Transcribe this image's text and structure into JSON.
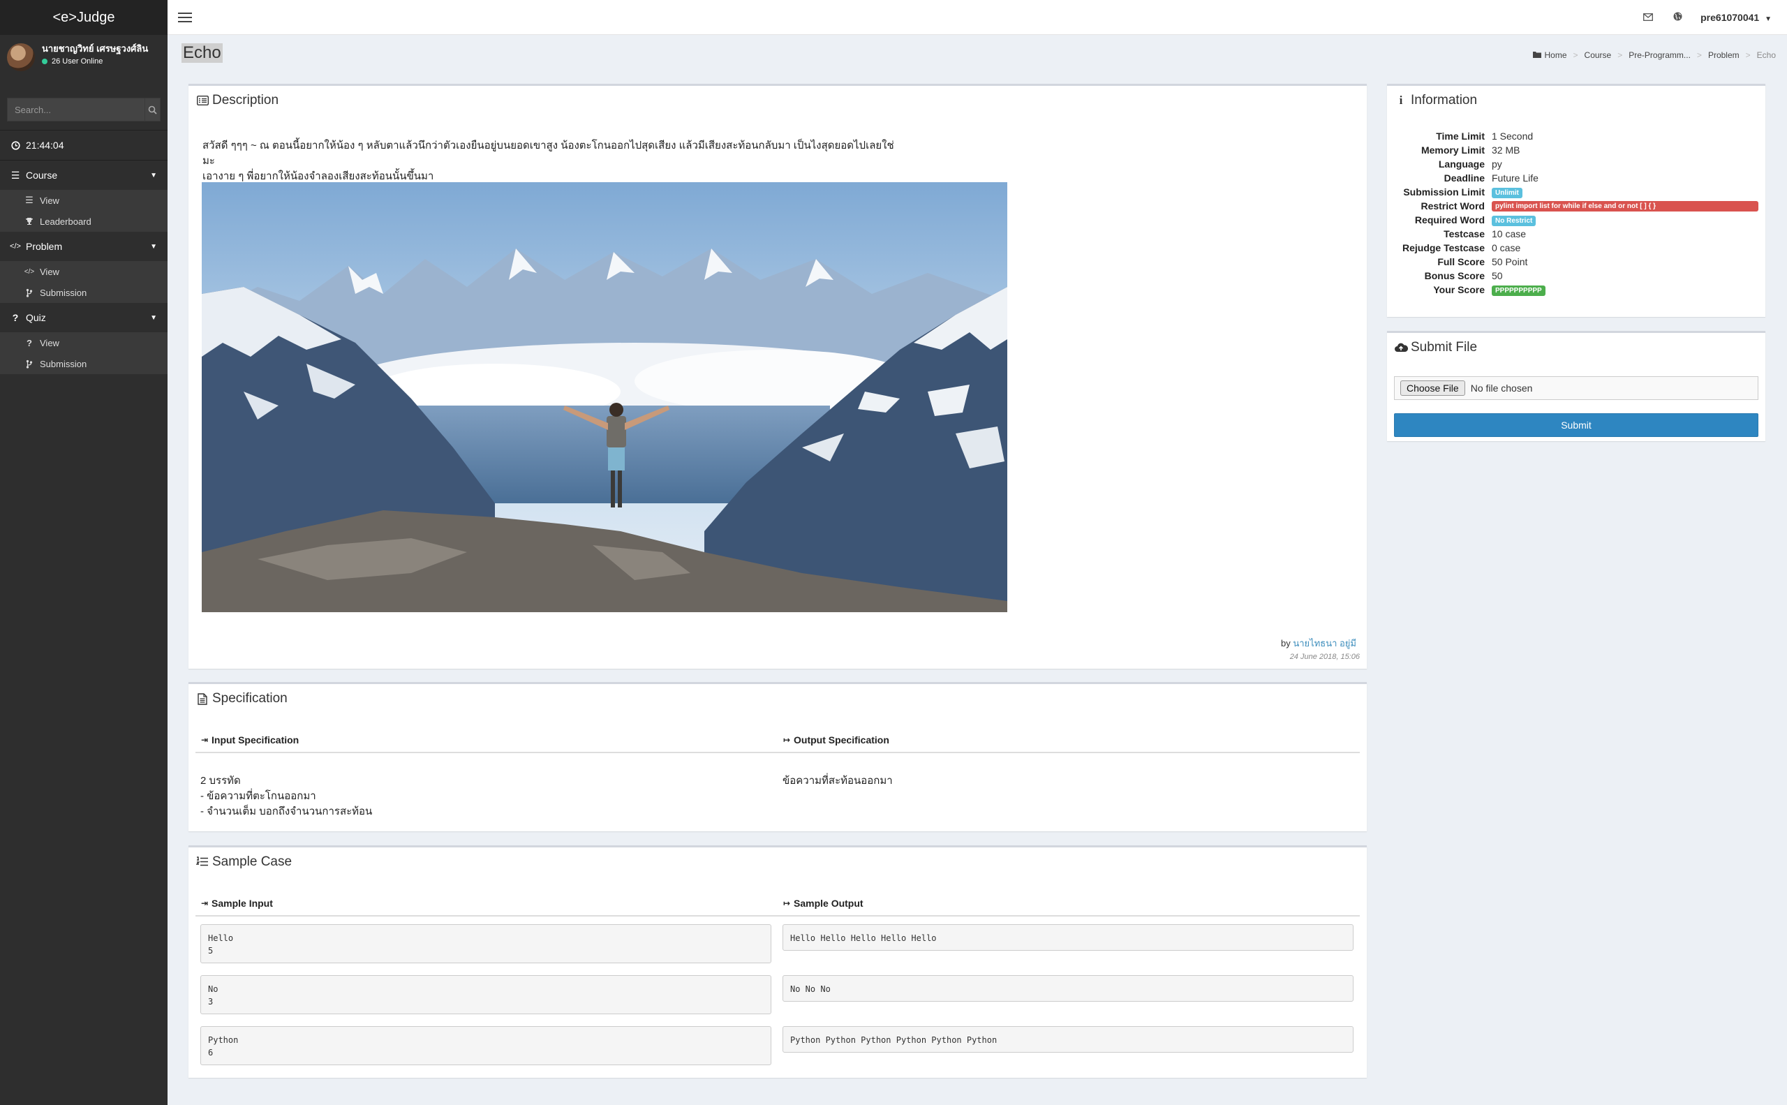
{
  "brand": "<e>Judge",
  "user": {
    "name": "นายชาญวิทย์ เศรษฐวงศ์ลิน",
    "online_text": "26 User Online"
  },
  "search": {
    "placeholder": "Search..."
  },
  "clock": "21:44:04",
  "sidebar": {
    "groups": [
      {
        "label": "Course",
        "icon": "list-icon",
        "items": [
          {
            "label": "View",
            "icon": "list-icon"
          },
          {
            "label": "Leaderboard",
            "icon": "trophy-icon"
          }
        ]
      },
      {
        "label": "Problem",
        "icon": "code-icon",
        "items": [
          {
            "label": "View",
            "icon": "code-icon"
          },
          {
            "label": "Submission",
            "icon": "branch-icon"
          }
        ]
      },
      {
        "label": "Quiz",
        "icon": "question-icon",
        "items": [
          {
            "label": "View",
            "icon": "question-icon"
          },
          {
            "label": "Submission",
            "icon": "branch-icon"
          }
        ]
      }
    ]
  },
  "topbar": {
    "username": "pre61070041"
  },
  "page": {
    "title": "Echo"
  },
  "breadcrumb": [
    "Home",
    "Course",
    "Pre-Programm...",
    "Problem",
    "Echo"
  ],
  "description": {
    "title": "Description",
    "text_line1": "สวัสดี ๆๆๆ ~ ณ ตอนนี้อยากให้น้อง ๆ หลับตาแล้วนึกว่าตัวเองยืนอยู่บนยอดเขาสูง น้องตะโกนออกไปสุดเสียง แล้วมีเสียงสะท้อนกลับมา เป็นไงสุดยอดไปเลยใช่มะ",
    "text_line2": "เอางาย ๆ พี่อยากให้น้องจำลองเสียงสะท้อนนั้นขึ้นมา",
    "by_label": "by",
    "author": "นายไทธนา อยู่มี",
    "date": "24 June 2018, 15:06"
  },
  "specification": {
    "title": "Specification",
    "input_head": "Input Specification",
    "output_head": "Output Specification",
    "input_lines": [
      "2 บรรทัด",
      "- ข้อความที่ตะโกนออกมา",
      "- จำนวนเต็ม บอกถึงจำนวนการสะท้อน"
    ],
    "output_text": "ข้อความที่สะท้อนออกมา"
  },
  "sample": {
    "title": "Sample Case",
    "input_head": "Sample Input",
    "output_head": "Sample Output",
    "cases": [
      {
        "input": "Hello\n5",
        "output": "Hello Hello Hello Hello Hello"
      },
      {
        "input": "No\n3",
        "output": "No No No"
      },
      {
        "input": "Python\n6",
        "output": "Python Python Python Python Python Python"
      }
    ]
  },
  "information": {
    "title": "Information",
    "rows": [
      {
        "label": "Time Limit",
        "value": "1 Second"
      },
      {
        "label": "Memory Limit",
        "value": "32 MB"
      },
      {
        "label": "Language",
        "value": "py"
      },
      {
        "label": "Deadline",
        "value": "Future Life"
      },
      {
        "label": "Submission Limit",
        "value": "Unlimit",
        "badge": "#5bc0de"
      },
      {
        "label": "Restrict Word",
        "value": "pylint import list for while if else and or not [ ] { }",
        "badge": "#d9534f",
        "wide": true
      },
      {
        "label": "Required Word",
        "value": "No Restrict",
        "badge": "#5bc0de"
      },
      {
        "label": "Testcase",
        "value": "10 case"
      },
      {
        "label": "Rejudge Testcase",
        "value": "0 case"
      },
      {
        "label": "Full Score",
        "value": "50 Point"
      },
      {
        "label": "Bonus Score",
        "value": "50"
      },
      {
        "label": "Your Score",
        "value": "PPPPPPPPPP",
        "badge": "#4cae4c"
      }
    ]
  },
  "submit": {
    "title": "Submit File",
    "choose_label": "Choose File",
    "no_file": "No file chosen",
    "submit_label": "Submit"
  },
  "colors": {
    "sidebar_bg": "#2e2e2e",
    "accent": "#3c8dbc",
    "submit_bg": "#2e86c1"
  }
}
